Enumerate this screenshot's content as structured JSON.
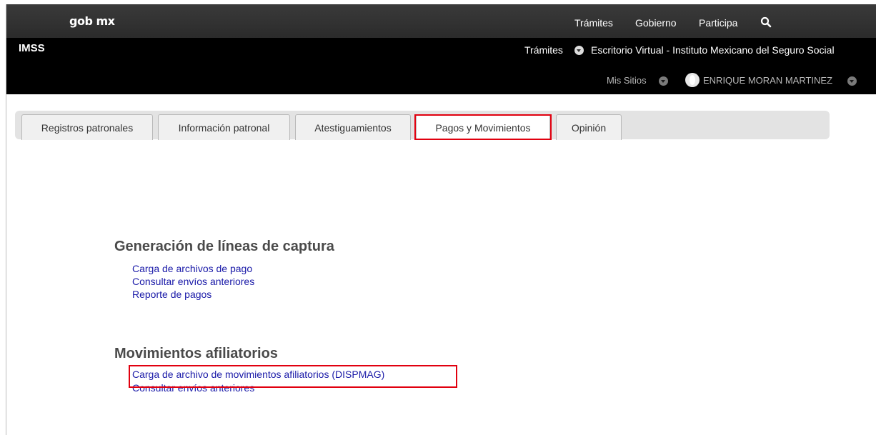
{
  "gob_header": {
    "logo": "gob mx",
    "nav": [
      "Trámites",
      "Gobierno",
      "Participa"
    ],
    "search_icon": "search-icon"
  },
  "imss_header": {
    "title": "IMSS",
    "tramites": "Trámites",
    "portal_title": "Escritorio Virtual - Instituto Mexicano del Seguro Social",
    "mis_sitios": "Mis Sitios",
    "user": "ENRIQUE MORAN MARTINEZ"
  },
  "tabs": [
    {
      "label": "Registros patronales"
    },
    {
      "label": "Información patronal"
    },
    {
      "label": "Atestiguamientos"
    },
    {
      "label": "Pagos y Movimientos",
      "active": true
    },
    {
      "label": "Opinión"
    }
  ],
  "sections": [
    {
      "title": "Generación de líneas de captura",
      "links": [
        "Carga de archivos de pago",
        "Consultar envíos anteriores",
        "Reporte de pagos"
      ]
    },
    {
      "title": "Movimientos afiliatorios",
      "links": [
        "Carga de archivo de movimientos afiliatorios (DISPMAG)",
        "Consultar envíos anteriores"
      ]
    }
  ],
  "colors": {
    "gob_bar": "#2f2f2f",
    "imss_bar": "#000000",
    "highlight": "#e1000f",
    "link": "#1a1aa8"
  }
}
